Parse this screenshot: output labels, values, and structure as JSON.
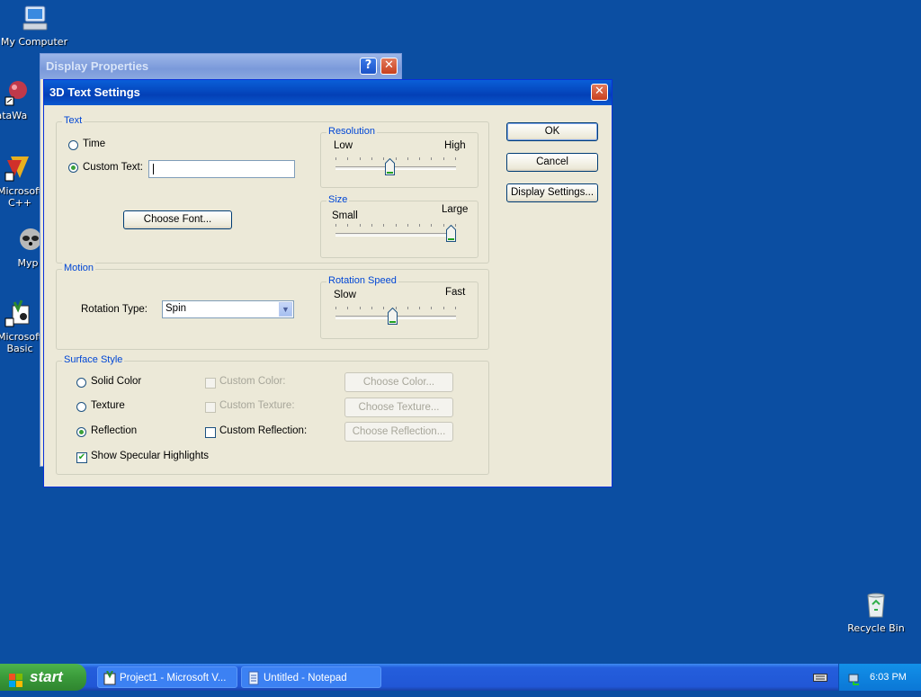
{
  "desktop": {
    "icons": [
      {
        "label": "My Computer"
      },
      {
        "label": "DataWa"
      },
      {
        "label": "Microsoft C++"
      },
      {
        "label": "Myp"
      },
      {
        "label": "Microsoft Basic"
      },
      {
        "label": "Recycle Bin"
      }
    ]
  },
  "display_properties": {
    "title": "Display Properties",
    "help": "?",
    "close": "✕"
  },
  "dialog": {
    "title": "3D Text Settings",
    "close": "✕",
    "text_group": {
      "label": "Text",
      "time_label": "Time",
      "custom_text_label": "Custom Text:",
      "custom_text_value": "",
      "choose_font": "Choose Font...",
      "selected": "custom_text"
    },
    "resolution": {
      "label": "Resolution",
      "low": "Low",
      "high": "High",
      "value_fraction": 0.45
    },
    "size": {
      "label": "Size",
      "small": "Small",
      "large": "Large",
      "value_fraction": 1.0
    },
    "motion": {
      "label": "Motion",
      "rotation_type_label": "Rotation Type:",
      "rotation_type_value": "Spin",
      "rotation_speed": {
        "label": "Rotation Speed",
        "slow": "Slow",
        "fast": "Fast",
        "value_fraction": 0.47
      }
    },
    "surface": {
      "label": "Surface Style",
      "solid_color": "Solid Color",
      "texture": "Texture",
      "reflection": "Reflection",
      "selected": "reflection",
      "custom_color": "Custom Color:",
      "custom_texture": "Custom Texture:",
      "custom_reflection": "Custom Reflection:",
      "choose_color": "Choose Color...",
      "choose_texture": "Choose Texture...",
      "choose_reflection": "Choose Reflection...",
      "show_specular": "Show Specular Highlights",
      "show_specular_checked": true
    },
    "buttons": {
      "ok": "OK",
      "cancel": "Cancel",
      "display_settings": "Display Settings..."
    }
  },
  "taskbar": {
    "start": "start",
    "tasks": [
      {
        "label": "Project1 - Microsoft V..."
      },
      {
        "label": "Untitled - Notepad"
      }
    ],
    "clock": "6:03 PM"
  }
}
